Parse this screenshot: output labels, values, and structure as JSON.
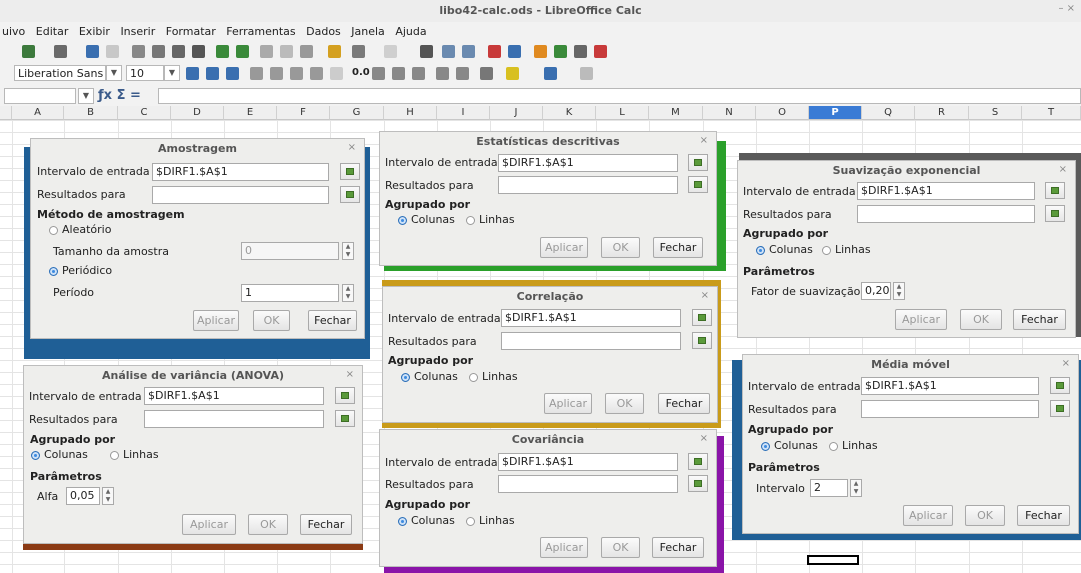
{
  "window": {
    "title": "libo42-calc.ods - LibreOffice Calc",
    "controls": "–  ×"
  },
  "menu": [
    "uivo",
    "Editar",
    "Exibir",
    "Inserir",
    "Formatar",
    "Ferramentas",
    "Dados",
    "Janela",
    "Ajuda"
  ],
  "format_toolbar": {
    "font_name": "Liberation Sans",
    "font_size": "10",
    "number_format": "0.0"
  },
  "formula_bar": {
    "symbols": "ƒx Σ ="
  },
  "columns": [
    "A",
    "B",
    "C",
    "D",
    "E",
    "F",
    "G",
    "H",
    "I",
    "J",
    "K",
    "L",
    "M",
    "N",
    "O",
    "P",
    "Q",
    "R",
    "S",
    "T"
  ],
  "selected_column": "P",
  "dialogs": {
    "amostragem": {
      "title": "Amostragem",
      "input_label": "Intervalo de entrada",
      "input_value": "$DIRF1.$A$1",
      "output_label": "Resultados para",
      "method_label": "Método de amostragem",
      "random_label": "Aleatório",
      "size_label": "Tamanho da amostra",
      "size_value": "0",
      "periodic_label": "Periódico",
      "period_label": "Período",
      "period_value": "1",
      "apply": "Aplicar",
      "ok": "OK",
      "close": "Fechar"
    },
    "descritivas": {
      "title": "Estatísticas descritivas",
      "input_label": "Intervalo de entrada",
      "input_value": "$DIRF1.$A$1",
      "output_label": "Resultados para",
      "group_label": "Agrupado por",
      "columns_label": "Colunas",
      "rows_label": "Linhas",
      "apply": "Aplicar",
      "ok": "OK",
      "close": "Fechar"
    },
    "suavizacao": {
      "title": "Suavização exponencial",
      "input_label": "Intervalo de entrada",
      "input_value": "$DIRF1.$A$1",
      "output_label": "Resultados para",
      "group_label": "Agrupado por",
      "columns_label": "Colunas",
      "rows_label": "Linhas",
      "params_label": "Parâmetros",
      "factor_label": "Fator de suavização",
      "factor_value": "0,20",
      "apply": "Aplicar",
      "ok": "OK",
      "close": "Fechar"
    },
    "correlacao": {
      "title": "Correlação",
      "input_label": "Intervalo de entrada",
      "input_value": "$DIRF1.$A$1",
      "output_label": "Resultados para",
      "group_label": "Agrupado por",
      "columns_label": "Colunas",
      "rows_label": "Linhas",
      "apply": "Aplicar",
      "ok": "OK",
      "close": "Fechar"
    },
    "anova": {
      "title": "Análise de variância (ANOVA)",
      "input_label": "Intervalo de entrada",
      "input_value": "$DIRF1.$A$1",
      "output_label": "Resultados para",
      "group_label": "Agrupado por",
      "columns_label": "Colunas",
      "rows_label": "Linhas",
      "params_label": "Parâmetros",
      "alpha_label": "Alfa",
      "alpha_value": "0,05",
      "apply": "Aplicar",
      "ok": "OK",
      "close": "Fechar"
    },
    "covariancia": {
      "title": "Covariância",
      "input_label": "Intervalo de entrada",
      "input_value": "$DIRF1.$A$1",
      "output_label": "Resultados para",
      "group_label": "Agrupado por",
      "columns_label": "Colunas",
      "rows_label": "Linhas",
      "apply": "Aplicar",
      "ok": "OK",
      "close": "Fechar"
    },
    "media_movel": {
      "title": "Média móvel",
      "input_label": "Intervalo de entrada",
      "input_value": "$DIRF1.$A$1",
      "output_label": "Resultados para",
      "group_label": "Agrupado por",
      "columns_label": "Colunas",
      "rows_label": "Linhas",
      "params_label": "Parâmetros",
      "interval_label": "Intervalo",
      "interval_value": "2",
      "apply": "Aplicar",
      "ok": "OK",
      "close": "Fechar"
    }
  },
  "colors": {
    "blue_frame": "#1f5f96",
    "green_frame": "#2aa02a",
    "gray_frame": "#5a5a5a",
    "gold_frame": "#c99b1a",
    "brown_frame": "#8b3a14",
    "purple_frame": "#8a14a8",
    "selection_accent": "#3a7bd5"
  }
}
